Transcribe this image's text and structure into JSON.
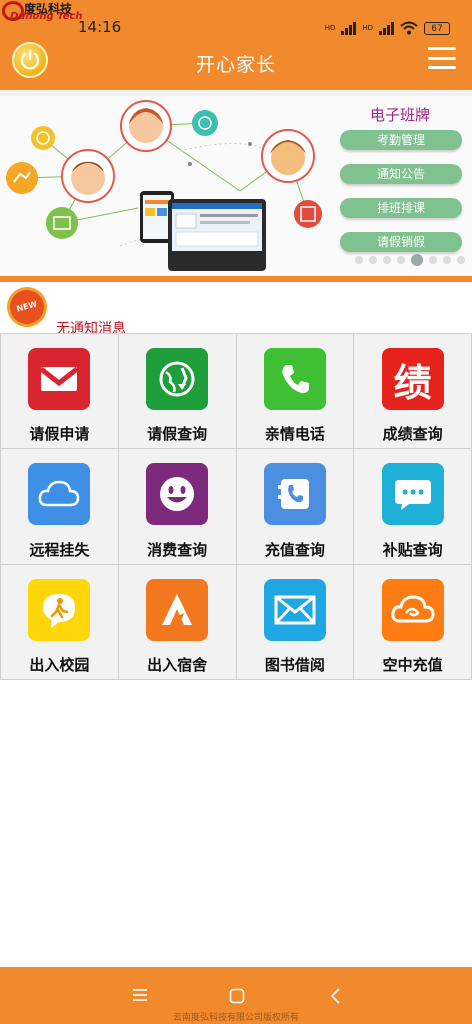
{
  "watermark": {
    "cn": "度弘科技",
    "en": "Duhong Tech"
  },
  "status_bar": {
    "time": "14:16",
    "battery": "67",
    "hd1": "HD",
    "hd2": "HD"
  },
  "header": {
    "title": "开心家长"
  },
  "banner": {
    "title": "电子班牌",
    "buttons": [
      "考勤管理",
      "通知公告",
      "排班排课",
      "请假销假"
    ],
    "active_slide": 5
  },
  "notice": {
    "badge": "NEW",
    "text": "无通知消息"
  },
  "grid": [
    {
      "label": "请假申请",
      "icon": "envelope-icon",
      "color": "#d8252f"
    },
    {
      "label": "请假查询",
      "icon": "globe-refresh-icon",
      "color": "#1f9e3c"
    },
    {
      "label": "亲情电话",
      "icon": "phone-icon",
      "color": "#3fbf34"
    },
    {
      "label": "成绩查询",
      "icon": "grade-icon",
      "color": "#e6221d",
      "glyph": "绩"
    },
    {
      "label": "远程挂失",
      "icon": "cloud-icon",
      "color": "#3e8fe6"
    },
    {
      "label": "消费查询",
      "icon": "smile-icon",
      "color": "#7d2a7c"
    },
    {
      "label": "充值查询",
      "icon": "contact-phone-icon",
      "color": "#4c8fe0"
    },
    {
      "label": "补贴查询",
      "icon": "chat-icon",
      "color": "#1eb0d6"
    },
    {
      "label": "出入校园",
      "icon": "walk-bubble-icon",
      "color": "#ffd60a"
    },
    {
      "label": "出入宿舍",
      "icon": "letter-a-icon",
      "color": "#f2771f"
    },
    {
      "label": "图书借阅",
      "icon": "mail-icon",
      "color": "#1fa7e4"
    },
    {
      "label": "空中充值",
      "icon": "cloud-swirl-icon",
      "color": "#ff7c12"
    }
  ],
  "footer": {
    "copyright": "云南度弘科技有限公司版权所有"
  },
  "theme": {
    "accent": "#f08a2c"
  }
}
